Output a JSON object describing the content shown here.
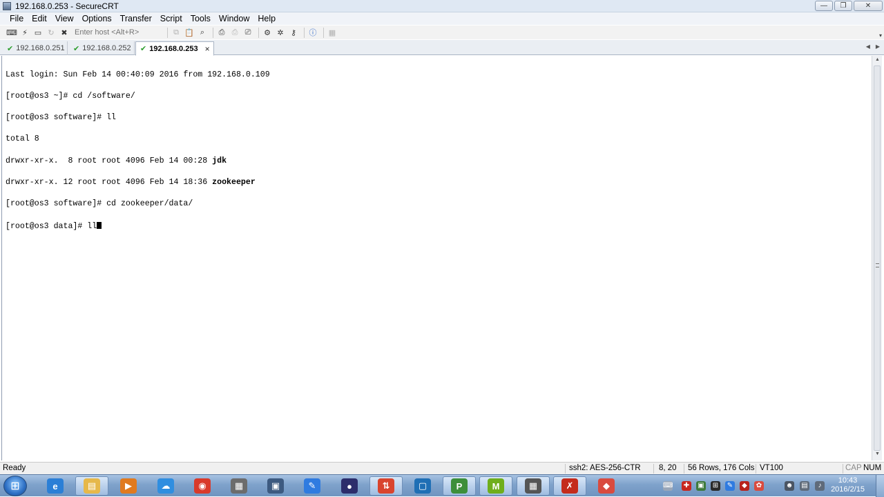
{
  "window": {
    "title": "192.168.0.253 - SecureCRT"
  },
  "window_controls": {
    "minimize": "—",
    "maximize": "❐",
    "close": "✕"
  },
  "menu": [
    "File",
    "Edit",
    "View",
    "Options",
    "Transfer",
    "Script",
    "Tools",
    "Window",
    "Help"
  ],
  "toolbar": {
    "host_placeholder": "Enter host <Alt+R>",
    "icons_left": [
      "connect-icon",
      "quick-connect-icon",
      "connect-in-tab-icon",
      "reconnect-icon",
      "disconnect-icon"
    ],
    "icons_right": [
      "copy-icon",
      "paste-icon",
      "find-icon",
      "print-icon",
      "print-selection-icon",
      "print-setup-icon",
      "session-options-icon",
      "global-options-icon",
      "keymap-icon",
      "help-icon",
      "sftp-icon"
    ]
  },
  "tabs": [
    {
      "label": "192.168.0.251",
      "active": false
    },
    {
      "label": "192.168.0.252",
      "active": false
    },
    {
      "label": "192.168.0.253",
      "active": true,
      "close": "×"
    }
  ],
  "tab_arrows": {
    "left": "◀",
    "right": "▶"
  },
  "terminal": {
    "lines": [
      {
        "text": "Last login: Sun Feb 14 00:40:09 2016 from 192.168.0.109"
      },
      {
        "text": "[root@os3 ~]# cd /software/"
      },
      {
        "text": "[root@os3 software]# ll"
      },
      {
        "text": "total 8"
      },
      {
        "text": "drwxr-xr-x.  8 root root 4096 Feb 14 00:28 ",
        "bold": "jdk"
      },
      {
        "text": "drwxr-xr-x. 12 root root 4096 Feb 14 18:36 ",
        "bold": "zookeeper"
      },
      {
        "text": "[root@os3 software]# cd zookeeper/data/"
      },
      {
        "text": "[root@os3 data]# ll",
        "cursor": true
      }
    ]
  },
  "scrollbar": {
    "up": "▲",
    "down": "▼"
  },
  "status": {
    "state": "Ready",
    "encryption": "ssh2: AES-256-CTR",
    "cursor_pos": "8,  20",
    "dimensions": "56 Rows, 176 Cols",
    "emulation": "VT100",
    "caps": "CAP",
    "num": "NUM"
  },
  "taskbar": {
    "apps": [
      {
        "name": "internet-explorer",
        "glyph": "e",
        "color": "#2b7fd6",
        "open": false
      },
      {
        "name": "file-explorer",
        "glyph": "▤",
        "color": "#e6b84a",
        "open": true
      },
      {
        "name": "media-player",
        "glyph": "▶",
        "color": "#e07a1f",
        "open": false
      },
      {
        "name": "baidu-cloud",
        "glyph": "☁",
        "color": "#2f8ee0",
        "open": false
      },
      {
        "name": "chrome",
        "glyph": "◉",
        "color": "#d93a2b",
        "open": false
      },
      {
        "name": "utility-app",
        "glyph": "▦",
        "color": "#6c6c6c",
        "open": false
      },
      {
        "name": "lock-app",
        "glyph": "▣",
        "color": "#3d5a80",
        "open": false
      },
      {
        "name": "feather-app",
        "glyph": "✎",
        "color": "#2f7be0",
        "open": false
      },
      {
        "name": "eclipse",
        "glyph": "●",
        "color": "#2c2d6b",
        "open": false
      },
      {
        "name": "ftp-app",
        "glyph": "⇅",
        "color": "#d9442e",
        "open": true
      },
      {
        "name": "virtualbox",
        "glyph": "▢",
        "color": "#1f6fb5",
        "open": false
      },
      {
        "name": "project-app",
        "glyph": "P",
        "color": "#3d8f3a",
        "open": true
      },
      {
        "name": "mindmap-app",
        "glyph": "M",
        "color": "#6fae1c",
        "open": true
      },
      {
        "name": "securecrt",
        "glyph": "▦",
        "color": "#555555",
        "open": true
      },
      {
        "name": "pdf-app",
        "glyph": "✗",
        "color": "#c42b1c",
        "open": true
      },
      {
        "name": "eraser-app",
        "glyph": "◆",
        "color": "#d94b3f",
        "open": false
      }
    ],
    "clock": {
      "time": "10:43",
      "date": "2016/2/15"
    }
  }
}
